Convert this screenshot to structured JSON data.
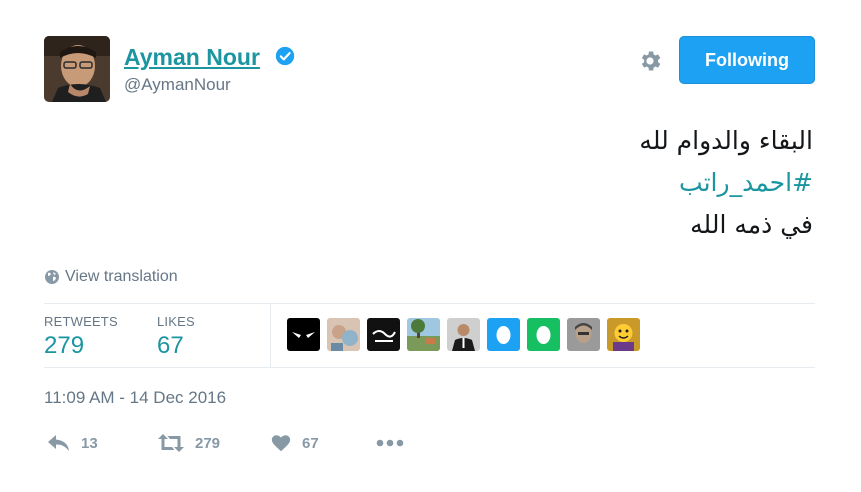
{
  "author": {
    "name": "Ayman Nour",
    "handle": "@AymanNour",
    "verified": true
  },
  "header": {
    "follow_label": "Following",
    "settings_icon": "gear-icon"
  },
  "tweet": {
    "line1": "البقاء والدوام لله",
    "hashtag": "#احمد_راتب",
    "line3": "في ذمه الله"
  },
  "translate_label": "View translation",
  "stats": {
    "retweets_label": "RETWEETS",
    "retweets_value": "279",
    "likes_label": "LIKES",
    "likes_value": "67"
  },
  "timestamp": "11:09 AM - 14 Dec 2016",
  "actions": {
    "reply_count": "13",
    "retweet_count": "279",
    "like_count": "67"
  },
  "colors": {
    "accent": "#1da1f2",
    "link": "#1b95a0",
    "muted": "#657786",
    "icon": "#8899a6"
  }
}
